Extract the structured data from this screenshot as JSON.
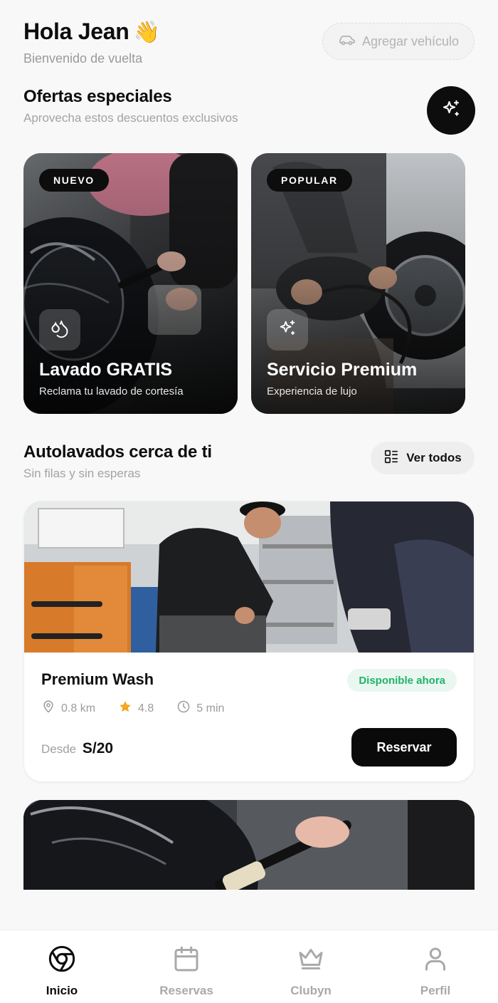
{
  "header": {
    "greeting": "Hola Jean",
    "wave_emoji": "👋",
    "welcome": "Bienvenido de vuelta",
    "add_vehicle_label": "Agregar vehículo",
    "add_vehicle_icon": "car-icon"
  },
  "offers": {
    "title": "Ofertas especiales",
    "subtitle": "Aprovecha estos descuentos exclusivos",
    "action_icon": "sparkles-icon",
    "cards": [
      {
        "tag": "NUEVO",
        "title": "Lavado GRATIS",
        "description": "Reclama tu lavado de cortesía",
        "icon": "droplets-icon"
      },
      {
        "tag": "POPULAR",
        "title": "Servicio Premium",
        "description": "Experiencia de lujo",
        "icon": "sparkles-icon"
      }
    ]
  },
  "nearby": {
    "title": "Autolavados cerca de ti",
    "subtitle": "Sin filas y sin esperas",
    "view_all_label": "Ver todos",
    "view_all_icon": "list-grid-icon",
    "items": [
      {
        "name": "Premium Wash",
        "status": "Disponible ahora",
        "distance": "0.8 km",
        "rating": "4.8",
        "wait": "5 min",
        "price_prefix": "Desde",
        "price": "S/20",
        "cta": "Reservar"
      }
    ]
  },
  "bottom_nav": [
    {
      "label": "Inicio",
      "icon": "home-chrome-icon",
      "active": true
    },
    {
      "label": "Reservas",
      "icon": "calendar-icon",
      "active": false
    },
    {
      "label": "Clubyn",
      "icon": "crown-icon",
      "active": false
    },
    {
      "label": "Perfil",
      "icon": "user-icon",
      "active": false
    }
  ],
  "colors": {
    "accent": "#0d0d0d",
    "available_green": "#20b36a",
    "available_bg": "#eaf7f0",
    "star": "#f5a623",
    "muted": "#9c9c9c"
  }
}
